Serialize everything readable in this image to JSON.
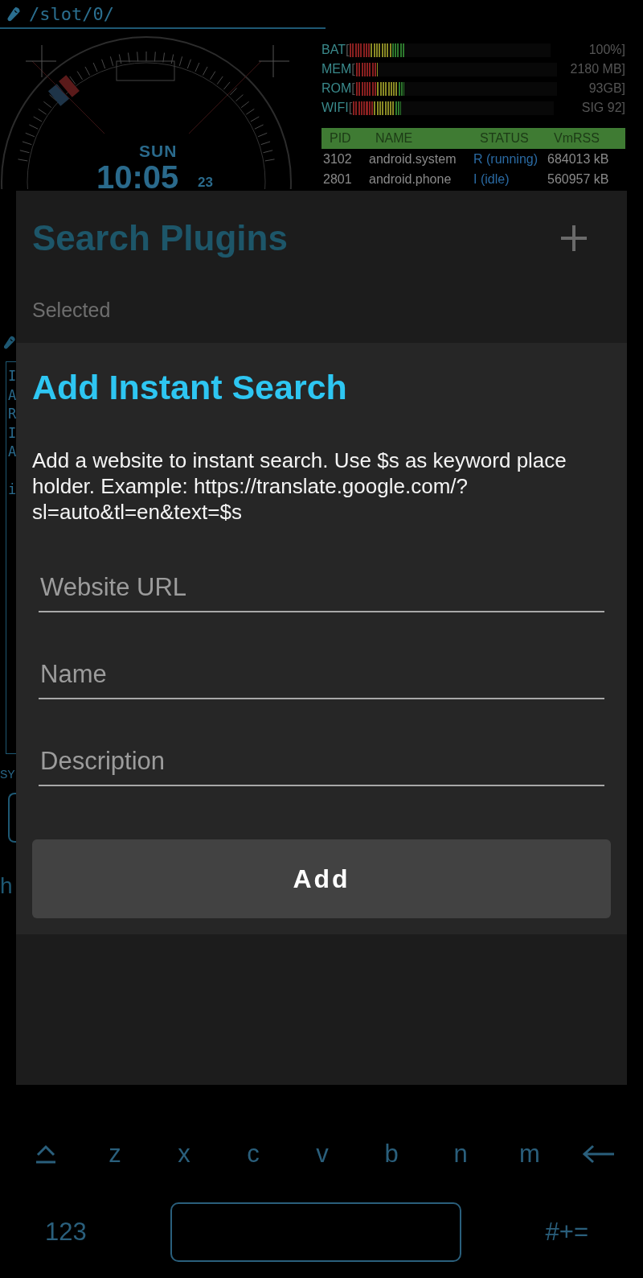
{
  "path_bar": {
    "path": "/slot/0/"
  },
  "clock": {
    "day": "SUN",
    "time": "10:05",
    "seconds": "23"
  },
  "meters": [
    {
      "label": "BAT",
      "open": "[",
      "level": 0.27,
      "reading": "100%]"
    },
    {
      "label": "MEM",
      "open": "[",
      "level": 0.11,
      "reading": "2180 MB]"
    },
    {
      "label": "ROM",
      "open": "[",
      "level": 0.24,
      "reading": "93GB]"
    },
    {
      "label": "WIFI",
      "open": "[",
      "level": 0.24,
      "reading": "SIG 92]"
    }
  ],
  "process_table": {
    "columns": [
      "PID",
      "NAME",
      "STATUS",
      "VmRSS"
    ],
    "rows": [
      {
        "pid": "3102",
        "name": "android.system",
        "status": "R (running)",
        "vmrss": "684013 kB"
      },
      {
        "pid": "2801",
        "name": "android.phone",
        "status": "I (idle)",
        "vmrss": "560957 kB"
      }
    ]
  },
  "background_terminal": {
    "lines": [
      "I",
      "A",
      "R",
      "I",
      "A"
    ],
    "last_line": "i"
  },
  "background_labels": {
    "section": "SY",
    "line": "h"
  },
  "search_plugins": {
    "title": "Search Plugins",
    "section": "Selected"
  },
  "dialog": {
    "title": "Add Instant Search",
    "description": "Add a website to instant search. Use $s as keyword place holder. Example: https://translate.google.com/?sl=auto&tl=en&text=$s",
    "fields": [
      {
        "placeholder": "Website URL"
      },
      {
        "placeholder": "Name"
      },
      {
        "placeholder": "Description"
      }
    ],
    "button": "Add"
  },
  "keyboard": {
    "rows": [
      [
        {
          "kind": "shift"
        },
        {
          "kind": "letter",
          "label": "z"
        },
        {
          "kind": "letter",
          "label": "x"
        },
        {
          "kind": "letter",
          "label": "c"
        },
        {
          "kind": "letter",
          "label": "v"
        },
        {
          "kind": "letter",
          "label": "b"
        },
        {
          "kind": "letter",
          "label": "n"
        },
        {
          "kind": "letter",
          "label": "m"
        },
        {
          "kind": "backspace"
        }
      ],
      [
        {
          "kind": "mode",
          "label": "123"
        },
        {
          "kind": "space"
        },
        {
          "kind": "mode",
          "label": "#+="
        }
      ]
    ]
  }
}
